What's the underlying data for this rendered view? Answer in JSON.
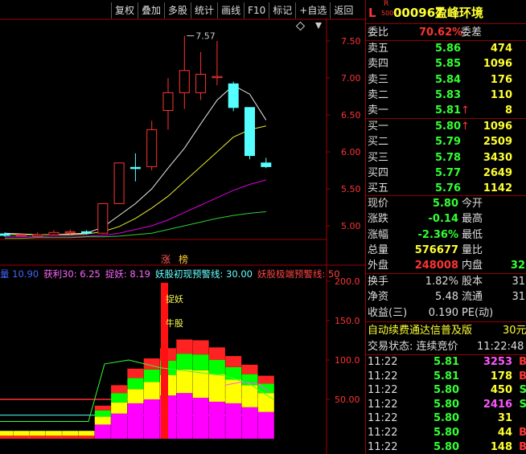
{
  "toolbar": {
    "buttons": [
      "复权",
      "叠加",
      "多股",
      "统计",
      "画线",
      "F10",
      "标记",
      "+自选",
      "返回"
    ]
  },
  "main_chart": {
    "price_ticks": [
      "7.50",
      "7.00",
      "6.50",
      "6.00",
      "5.50",
      "5.00"
    ],
    "high_label": "7.57",
    "tags": [
      "涨",
      "榜"
    ],
    "candles": [
      {
        "o": 4.89,
        "c": 4.87,
        "h": 4.91,
        "l": 4.85
      },
      {
        "o": 4.87,
        "c": 4.88,
        "h": 4.9,
        "l": 4.86
      },
      {
        "o": 4.86,
        "c": 4.88,
        "h": 4.91,
        "l": 4.84
      },
      {
        "o": 4.88,
        "c": 4.91,
        "h": 4.94,
        "l": 4.87
      },
      {
        "o": 4.91,
        "c": 4.92,
        "h": 4.95,
        "l": 4.88
      },
      {
        "o": 4.92,
        "c": 4.9,
        "h": 4.94,
        "l": 4.88
      },
      {
        "o": 4.9,
        "c": 5.3,
        "h": 5.3,
        "l": 4.89
      },
      {
        "o": 5.3,
        "c": 5.85,
        "h": 5.85,
        "l": 5.3
      },
      {
        "o": 5.79,
        "c": 5.78,
        "h": 5.98,
        "l": 5.6
      },
      {
        "o": 5.8,
        "c": 6.3,
        "h": 6.42,
        "l": 5.75
      },
      {
        "o": 6.56,
        "c": 6.8,
        "h": 7.0,
        "l": 6.3
      },
      {
        "o": 6.8,
        "c": 7.1,
        "h": 7.57,
        "l": 6.58
      },
      {
        "o": 6.8,
        "c": 7.05,
        "h": 7.35,
        "l": 6.7
      },
      {
        "o": 7.02,
        "c": 7.02,
        "h": 7.5,
        "l": 6.9
      },
      {
        "o": 6.92,
        "c": 6.6,
        "h": 6.95,
        "l": 6.55
      },
      {
        "o": 6.6,
        "c": 5.95,
        "h": 6.6,
        "l": 5.9
      },
      {
        "o": 5.85,
        "c": 5.8,
        "h": 5.92,
        "l": 5.78
      }
    ],
    "ma_lines": [
      {
        "color": "#e8e8e8",
        "values": [
          4.9,
          4.89,
          4.88,
          4.88,
          4.89,
          4.9,
          4.98,
          5.14,
          5.3,
          5.5,
          5.78,
          6.05,
          6.38,
          6.7,
          6.9,
          6.78,
          6.43
        ]
      },
      {
        "color": "#e8e833",
        "values": [
          4.88,
          4.88,
          4.88,
          4.88,
          4.88,
          4.89,
          4.92,
          4.99,
          5.1,
          5.24,
          5.4,
          5.6,
          5.8,
          6.0,
          6.2,
          6.3,
          6.35
        ]
      },
      {
        "color": "#e000e0",
        "values": [
          4.85,
          4.85,
          4.85,
          4.86,
          4.86,
          4.86,
          4.87,
          4.9,
          4.95,
          5.0,
          5.08,
          5.18,
          5.28,
          5.38,
          5.48,
          5.56,
          5.62
        ]
      },
      {
        "color": "#33cc33",
        "values": [
          4.83,
          4.83,
          4.84,
          4.84,
          4.84,
          4.85,
          4.85,
          4.86,
          4.88,
          4.9,
          4.95,
          5.0,
          5.05,
          5.1,
          5.14,
          5.17,
          5.19
        ]
      }
    ]
  },
  "indicator": {
    "labels": [
      {
        "text": "量 10.90",
        "color": "#4466ff"
      },
      {
        "text": "获利30: 6.25",
        "color": "#ff66ff"
      },
      {
        "text": "捉妖: 8.19",
        "color": "#ff66ff"
      },
      {
        "text": "妖股初现预警线: 30.00",
        "color": "#66ffff"
      },
      {
        "text": "妖股极端预警线: 50",
        "color": "#ff4444"
      }
    ],
    "ticks": [
      "200.0",
      "150.0",
      "100.0",
      "50.00"
    ],
    "signals": [
      "捉妖",
      "牛股"
    ]
  },
  "stock": {
    "prefix": "L",
    "rights": "R",
    "code_small": "500",
    "code": "000967",
    "name": "盈峰环境"
  },
  "commission": {
    "label": "委比",
    "value": "70.62%",
    "label2": "委差"
  },
  "asks": [
    {
      "label": "卖五",
      "price": "5.86",
      "vol": "474",
      "arrow": ""
    },
    {
      "label": "卖四",
      "price": "5.85",
      "vol": "1096",
      "arrow": ""
    },
    {
      "label": "卖三",
      "price": "5.84",
      "vol": "176",
      "arrow": ""
    },
    {
      "label": "卖二",
      "price": "5.83",
      "vol": "110",
      "arrow": ""
    },
    {
      "label": "卖一",
      "price": "5.81",
      "vol": "8",
      "arrow": "↑"
    }
  ],
  "bids": [
    {
      "label": "买一",
      "price": "5.80",
      "vol": "1096",
      "arrow": "↑"
    },
    {
      "label": "买二",
      "price": "5.79",
      "vol": "2509",
      "arrow": ""
    },
    {
      "label": "买三",
      "price": "5.78",
      "vol": "3430",
      "arrow": ""
    },
    {
      "label": "买四",
      "price": "5.77",
      "vol": "2649",
      "arrow": ""
    },
    {
      "label": "买五",
      "price": "5.76",
      "vol": "1142",
      "arrow": ""
    }
  ],
  "quote": [
    {
      "l1": "现价",
      "v1": "5.80",
      "c1": "#33ff33",
      "l2": "今开",
      "v2": ""
    },
    {
      "l1": "涨跌",
      "v1": "-0.14",
      "c1": "#33ff33",
      "l2": "最高",
      "v2": ""
    },
    {
      "l1": "涨幅",
      "v1": "-2.36%",
      "c1": "#33ff33",
      "l2": "最低",
      "v2": ""
    },
    {
      "l1": "总量",
      "v1": "576677",
      "c1": "#ffff33",
      "l2": "量比",
      "v2": ""
    },
    {
      "l1": "外盘",
      "v1": "248008",
      "c1": "#ff3333",
      "l2": "内盘",
      "v2": "32"
    }
  ],
  "fundamentals": [
    {
      "l1": "换手",
      "v1": "1.82%",
      "l2": "股本",
      "v2": "31"
    },
    {
      "l1": "净资",
      "v1": "5.48",
      "l2": "流通",
      "v2": "31"
    },
    {
      "l1": "收益(三)",
      "v1": "0.190",
      "l2": "PE(动)",
      "v2": ""
    }
  ],
  "promo": {
    "text": "自动续费通达信普及版",
    "price": "30元"
  },
  "trade_status": {
    "text": "交易状态: 连续竞价",
    "time": "11:22:48"
  },
  "ticks_list": [
    {
      "time": "11:22",
      "price": "5.81",
      "vol": "3253",
      "vcolor": "#ff55ff",
      "side": "B",
      "scolor": "#ff3333"
    },
    {
      "time": "11:22",
      "price": "5.81",
      "vol": "178",
      "vcolor": "#ffff33",
      "side": "B",
      "scolor": "#ff3333"
    },
    {
      "time": "11:22",
      "price": "5.80",
      "vol": "450",
      "vcolor": "#ffff33",
      "side": "S",
      "scolor": "#33ff33"
    },
    {
      "time": "11:22",
      "price": "5.80",
      "vol": "2416",
      "vcolor": "#ff55ff",
      "side": "S",
      "scolor": "#33ff33"
    },
    {
      "time": "11:22",
      "price": "5.80",
      "vol": "31",
      "vcolor": "#ffff33",
      "side": "",
      "scolor": "#33ff33"
    },
    {
      "time": "11:22",
      "price": "5.80",
      "vol": "44",
      "vcolor": "#ffff33",
      "side": "B",
      "scolor": "#ff3333"
    },
    {
      "time": "11:22",
      "price": "5.80",
      "vol": "148",
      "vcolor": "#ffff33",
      "side": "B",
      "scolor": "#ff3333"
    }
  ]
}
